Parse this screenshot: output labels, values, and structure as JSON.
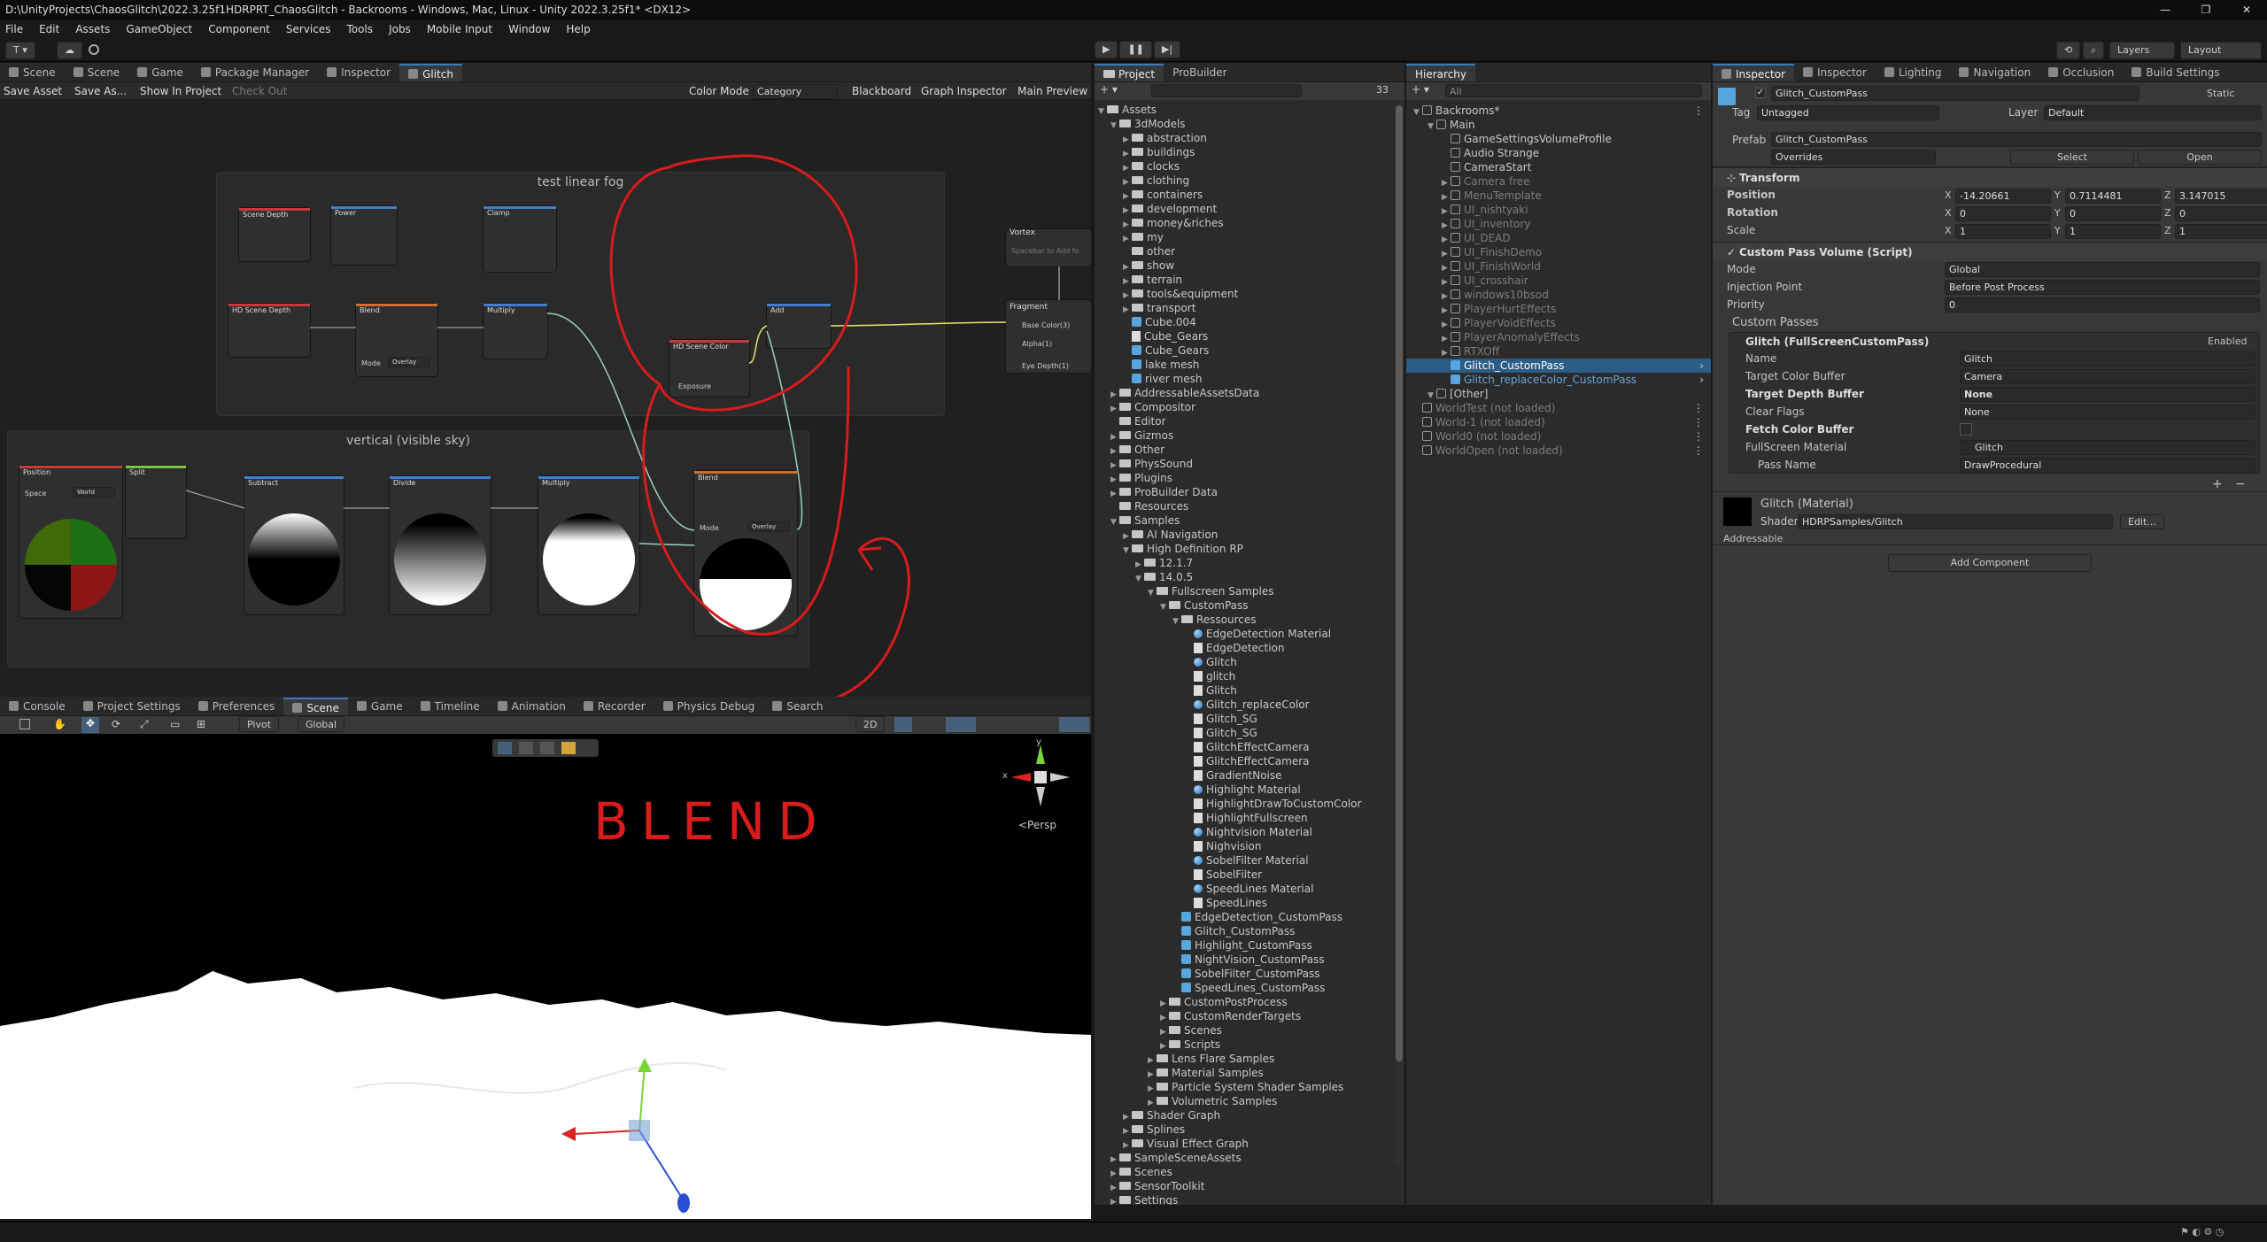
{
  "window": {
    "title": "D:\\UnityProjects\\ChaosGlitch\\2022.3.25f1HDRPRT_ChaosGlitch - Backrooms - Windows, Mac, Linux - Unity 2022.3.25f1* <DX12>",
    "controls": [
      "—",
      "❐",
      "✕"
    ]
  },
  "menu": [
    "File",
    "Edit",
    "Assets",
    "GameObject",
    "Component",
    "Services",
    "Tools",
    "Jobs",
    "Mobile Input",
    "Window",
    "Help"
  ],
  "toolbar": {
    "account": "T ▾",
    "cloud": "☁",
    "play": "▶",
    "pause": "❚❚",
    "step": "▶|",
    "layers": "Layers",
    "layout": "Layout"
  },
  "left_tabs": [
    "Scene",
    "Scene",
    "Game",
    "Package Manager",
    "Inspector",
    "Glitch"
  ],
  "graph_toolbar": {
    "save": "Save Asset",
    "save_as": "Save As...",
    "show": "Show In Project",
    "checkout": "Check Out",
    "color_mode_label": "Color Mode",
    "color_mode_value": "Category",
    "blackboard": "Blackboard",
    "graph_inspector": "Graph Inspector",
    "main_preview": "Main Preview"
  },
  "graph": {
    "group1_title": "test linear fog",
    "group2_title": "vertical (visible sky)",
    "nodes": {
      "scene_depth": "Scene Depth",
      "power": "Power",
      "clamp": "Clamp",
      "hd_scene_depth": "HD Scene Depth",
      "blend": "Blend",
      "multiply": "Multiply",
      "add": "Add",
      "hd_scene_color": "HD Scene Color",
      "fragment": "Fragment",
      "vortex": "Vortex",
      "vortex_hint": "Spacebar to Add fo",
      "position": "Position",
      "split": "Split",
      "subtract": "Subtract",
      "divide": "Divide",
      "multiply2": "Multiply",
      "blend2": "Blend",
      "mode": "Mode",
      "overlay": "Overlay",
      "frag_base": "Base Color(3)",
      "frag_alpha": "Alpha(1)",
      "frag_eye": "Eye Depth(1)",
      "exposure": "Exposure",
      "space": "Space",
      "world": "World"
    },
    "annotation": "BLEND"
  },
  "bottom_tabs": [
    "Console",
    "Project Settings",
    "Preferences",
    "Scene",
    "Game",
    "Timeline",
    "Animation",
    "Recorder",
    "Physics Debug",
    "Search"
  ],
  "scene_toolbar": {
    "pivot": "Pivot",
    "global": "Global",
    "mode2d": "2D",
    "persp": "<Persp",
    "gizmo_x": "x",
    "gizmo_y": "y"
  },
  "project": {
    "tabs": [
      "Project",
      "ProBuilder"
    ],
    "count": "33",
    "rows": [
      {
        "l": "Assets",
        "d": 0,
        "t": "folder",
        "o": true
      },
      {
        "l": "3dModels",
        "d": 1,
        "t": "folder",
        "o": true
      },
      {
        "l": "abstraction",
        "d": 2,
        "t": "folder"
      },
      {
        "l": "buildings",
        "d": 2,
        "t": "folder"
      },
      {
        "l": "clocks",
        "d": 2,
        "t": "folder"
      },
      {
        "l": "clothing",
        "d": 2,
        "t": "folder"
      },
      {
        "l": "containers",
        "d": 2,
        "t": "folder"
      },
      {
        "l": "development",
        "d": 2,
        "t": "folder"
      },
      {
        "l": "money&riches",
        "d": 2,
        "t": "folder"
      },
      {
        "l": "my",
        "d": 2,
        "t": "folder"
      },
      {
        "l": "other",
        "d": 2,
        "t": "folder",
        "n": 1
      },
      {
        "l": "show",
        "d": 2,
        "t": "folder"
      },
      {
        "l": "terrain",
        "d": 2,
        "t": "folder"
      },
      {
        "l": "tools&equipment",
        "d": 2,
        "t": "folder"
      },
      {
        "l": "transport",
        "d": 2,
        "t": "folder"
      },
      {
        "l": "Cube.004",
        "d": 2,
        "t": "cube"
      },
      {
        "l": "Cube_Gears",
        "d": 2,
        "t": "file"
      },
      {
        "l": "Cube_Gears",
        "d": 2,
        "t": "cube"
      },
      {
        "l": "lake mesh",
        "d": 2,
        "t": "cube"
      },
      {
        "l": "river mesh",
        "d": 2,
        "t": "cube"
      },
      {
        "l": "AddressableAssetsData",
        "d": 1,
        "t": "folder"
      },
      {
        "l": "Compositor",
        "d": 1,
        "t": "folder"
      },
      {
        "l": "Editor",
        "d": 1,
        "t": "folder",
        "n": 1
      },
      {
        "l": "Gizmos",
        "d": 1,
        "t": "folder"
      },
      {
        "l": "Other",
        "d": 1,
        "t": "folder"
      },
      {
        "l": "PhysSound",
        "d": 1,
        "t": "folder"
      },
      {
        "l": "Plugins",
        "d": 1,
        "t": "folder"
      },
      {
        "l": "ProBuilder Data",
        "d": 1,
        "t": "folder"
      },
      {
        "l": "Resources",
        "d": 1,
        "t": "folder",
        "n": 1
      },
      {
        "l": "Samples",
        "d": 1,
        "t": "folder",
        "o": true
      },
      {
        "l": "AI Navigation",
        "d": 2,
        "t": "folder"
      },
      {
        "l": "High Definition RP",
        "d": 2,
        "t": "folder",
        "o": true
      },
      {
        "l": "12.1.7",
        "d": 3,
        "t": "folder"
      },
      {
        "l": "14.0.5",
        "d": 3,
        "t": "folder",
        "o": true
      },
      {
        "l": "Fullscreen Samples",
        "d": 4,
        "t": "folder",
        "o": true
      },
      {
        "l": "CustomPass",
        "d": 5,
        "t": "folder",
        "o": true
      },
      {
        "l": "Ressources",
        "d": 6,
        "t": "folder",
        "o": true
      },
      {
        "l": "EdgeDetection Material",
        "d": 7,
        "t": "mat"
      },
      {
        "l": "EdgeDetection",
        "d": 7,
        "t": "file"
      },
      {
        "l": "Glitch",
        "d": 7,
        "t": "mat"
      },
      {
        "l": "glitch",
        "d": 7,
        "t": "file"
      },
      {
        "l": "Glitch",
        "d": 7,
        "t": "file"
      },
      {
        "l": "Glitch_replaceColor",
        "d": 7,
        "t": "mat"
      },
      {
        "l": "Glitch_SG",
        "d": 7,
        "t": "file"
      },
      {
        "l": "Glitch_SG",
        "d": 7,
        "t": "file"
      },
      {
        "l": "GlitchEffectCamera",
        "d": 7,
        "t": "file"
      },
      {
        "l": "GlitchEffectCamera",
        "d": 7,
        "t": "file"
      },
      {
        "l": "GradientNoise",
        "d": 7,
        "t": "file"
      },
      {
        "l": "Highlight Material",
        "d": 7,
        "t": "mat"
      },
      {
        "l": "HighlightDrawToCustomColor",
        "d": 7,
        "t": "file"
      },
      {
        "l": "HighlightFullscreen",
        "d": 7,
        "t": "file"
      },
      {
        "l": "Nightvision Material",
        "d": 7,
        "t": "mat"
      },
      {
        "l": "Nighvision",
        "d": 7,
        "t": "file"
      },
      {
        "l": "SobelFilter Material",
        "d": 7,
        "t": "mat"
      },
      {
        "l": "SobelFilter",
        "d": 7,
        "t": "file"
      },
      {
        "l": "SpeedLines Material",
        "d": 7,
        "t": "mat"
      },
      {
        "l": "SpeedLines",
        "d": 7,
        "t": "file"
      },
      {
        "l": "EdgeDetection_CustomPass",
        "d": 6,
        "t": "cube"
      },
      {
        "l": "Glitch_CustomPass",
        "d": 6,
        "t": "cube"
      },
      {
        "l": "Highlight_CustomPass",
        "d": 6,
        "t": "cube"
      },
      {
        "l": "NightVision_CustomPass",
        "d": 6,
        "t": "cube"
      },
      {
        "l": "SobelFilter_CustomPass",
        "d": 6,
        "t": "cube"
      },
      {
        "l": "SpeedLines_CustomPass",
        "d": 6,
        "t": "cube"
      },
      {
        "l": "CustomPostProcess",
        "d": 5,
        "t": "folder"
      },
      {
        "l": "CustomRenderTargets",
        "d": 5,
        "t": "folder"
      },
      {
        "l": "Scenes",
        "d": 5,
        "t": "folder"
      },
      {
        "l": "Scripts",
        "d": 5,
        "t": "folder"
      },
      {
        "l": "Lens Flare Samples",
        "d": 4,
        "t": "folder"
      },
      {
        "l": "Material Samples",
        "d": 4,
        "t": "folder"
      },
      {
        "l": "Particle System Shader Samples",
        "d": 4,
        "t": "folder"
      },
      {
        "l": "Volumetric Samples",
        "d": 4,
        "t": "folder"
      },
      {
        "l": "Shader Graph",
        "d": 2,
        "t": "folder"
      },
      {
        "l": "Splines",
        "d": 2,
        "t": "folder"
      },
      {
        "l": "Visual Effect Graph",
        "d": 2,
        "t": "folder"
      },
      {
        "l": "SampleSceneAssets",
        "d": 1,
        "t": "folder"
      },
      {
        "l": "Scenes",
        "d": 1,
        "t": "folder"
      },
      {
        "l": "SensorToolkit",
        "d": 1,
        "t": "folder"
      },
      {
        "l": "Settings",
        "d": 1,
        "t": "folder"
      }
    ]
  },
  "hierarchy": {
    "tab": "Hierarchy",
    "search": "All",
    "rows": [
      {
        "l": "Backrooms*",
        "d": 0,
        "k": "scene"
      },
      {
        "l": "Main",
        "d": 1,
        "k": "obj"
      },
      {
        "l": "GameSettingsVolumeProfile",
        "d": 2,
        "k": "obj"
      },
      {
        "l": "Audio Strange",
        "d": 2,
        "k": "obj"
      },
      {
        "l": "CameraStart",
        "d": 2,
        "k": "obj"
      },
      {
        "l": "Camera free",
        "d": 2,
        "k": "dim"
      },
      {
        "l": "MenuTemplate",
        "d": 2,
        "k": "dim"
      },
      {
        "l": "UI_nishtyaki",
        "d": 2,
        "k": "dim"
      },
      {
        "l": "UI_inventory",
        "d": 2,
        "k": "dim"
      },
      {
        "l": "UI_DEAD",
        "d": 2,
        "k": "dim"
      },
      {
        "l": "UI_FinishDemo",
        "d": 2,
        "k": "dim"
      },
      {
        "l": "UI_FinishWorld",
        "d": 2,
        "k": "dim"
      },
      {
        "l": "UI_crosshair",
        "d": 2,
        "k": "dim"
      },
      {
        "l": "windows10bsod",
        "d": 2,
        "k": "dim"
      },
      {
        "l": "PlayerHurtEffects",
        "d": 2,
        "k": "dim"
      },
      {
        "l": "PlayerVoidEffects",
        "d": 2,
        "k": "dim"
      },
      {
        "l": "PlayerAnomalyEffects",
        "d": 2,
        "k": "dim"
      },
      {
        "l": "RTXOff",
        "d": 2,
        "k": "dim"
      },
      {
        "l": "Glitch_CustomPass",
        "d": 2,
        "k": "sel"
      },
      {
        "l": "Glitch_replaceColor_CustomPass",
        "d": 2,
        "k": "blue"
      },
      {
        "l": "[Other]",
        "d": 1,
        "k": "obj"
      },
      {
        "l": "WorldTest (not loaded)",
        "d": 0,
        "k": "unloaded"
      },
      {
        "l": "World-1 (not loaded)",
        "d": 0,
        "k": "unloaded"
      },
      {
        "l": "World0 (not loaded)",
        "d": 0,
        "k": "unloaded"
      },
      {
        "l": "WorldOpen (not loaded)",
        "d": 0,
        "k": "unloaded"
      }
    ]
  },
  "inspector": {
    "tabs": [
      "Inspector",
      "Inspector",
      "Lighting",
      "Navigation",
      "Occlusion",
      "Build Settings"
    ],
    "object_name": "Glitch_CustomPass",
    "static": "Static",
    "tag_label": "Tag",
    "tag": "Untagged",
    "layer_label": "Layer",
    "layer": "Default",
    "prefab_label": "Prefab",
    "prefab": "Glitch_CustomPass",
    "overrides": "Overrides",
    "select": "Select",
    "open": "Open",
    "transform": {
      "title": "Transform",
      "position": "Position",
      "rotation": "Rotation",
      "scale": "Scale",
      "pos": [
        "-14.20661",
        "0.7114481",
        "3.147015"
      ],
      "rot": [
        "0",
        "0",
        "0"
      ],
      "scl": [
        "1",
        "1",
        "1"
      ],
      "axes": [
        "X",
        "Y",
        "Z"
      ]
    },
    "cpv": {
      "title": "Custom Pass Volume (Script)",
      "mode_label": "Mode",
      "mode": "Global",
      "inj_label": "Injection Point",
      "inj": "Before Post Process",
      "prio_label": "Priority",
      "prio": "0",
      "passes_label": "Custom Passes",
      "pass_title": "Glitch (FullScreenCustomPass)",
      "enabled": "Enabled",
      "name_label": "Name",
      "name": "Glitch",
      "tcb_label": "Target Color Buffer",
      "tcb": "Camera",
      "tdb_label": "Target Depth Buffer",
      "tdb": "None",
      "clear_label": "Clear Flags",
      "clear": "None",
      "fetch_label": "Fetch Color Buffer",
      "fsm_label": "FullScreen Material",
      "fsm": "Glitch",
      "pass_label": "Pass Name",
      "pass": "DrawProcedural"
    },
    "material": {
      "title": "Glitch (Material)",
      "shader_label": "Shader",
      "shader": "HDRPSamples/Glitch",
      "edit": "Edit..."
    },
    "addressable": "Addressable",
    "add_component": "Add Component"
  }
}
